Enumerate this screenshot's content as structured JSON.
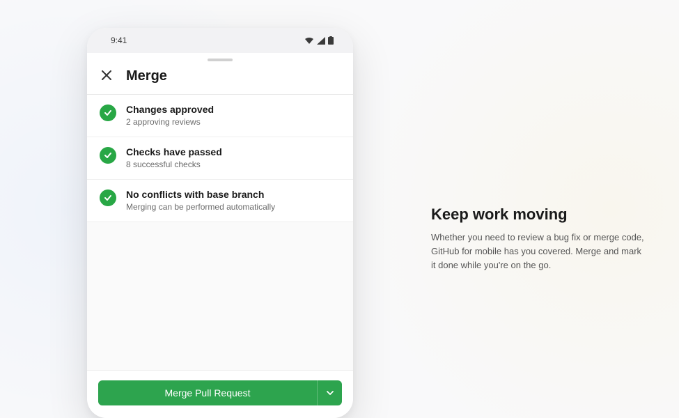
{
  "status_bar": {
    "time": "9:41"
  },
  "header": {
    "title": "Merge"
  },
  "checks": [
    {
      "title": "Changes approved",
      "subtitle": "2 approving reviews"
    },
    {
      "title": "Checks have passed",
      "subtitle": "8 successful checks"
    },
    {
      "title": "No conflicts with base branch",
      "subtitle": "Merging can be performed automatically"
    }
  ],
  "footer": {
    "merge_button": "Merge Pull Request"
  },
  "marketing": {
    "title": "Keep work moving",
    "copy": "Whether you need to review a bug fix or merge code, GitHub for mobile has you covered. Merge and mark it done while you're on the go."
  },
  "colors": {
    "success": "#28a745",
    "button": "#2da44e"
  }
}
